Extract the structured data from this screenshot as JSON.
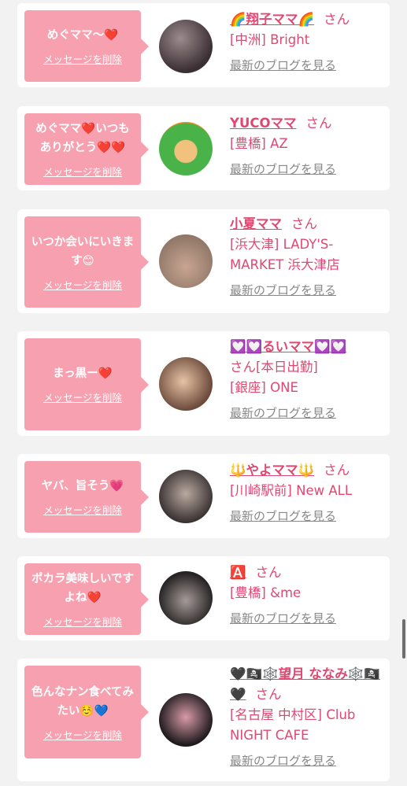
{
  "delete_label": "メッセージを削除",
  "blog_label": "最新のブログを見る",
  "san_label": "さん",
  "cards": [
    {
      "message": "めぐママ〜❤️",
      "name": "🌈翔子ママ🌈",
      "san": "さん",
      "shop": "[中洲] Bright"
    },
    {
      "message": "めぐママ❤️いつもありがとう❤️❤️",
      "name": "YUCOママ",
      "san": "さん",
      "shop": "[豊橋] AZ"
    },
    {
      "message": "いつか会いにいきます😊",
      "name": "小夏ママ",
      "san": "さん",
      "shop": "[浜大津] LADY'S-MARKET 浜大津店"
    },
    {
      "message": "まっ黒ー❤️",
      "name": "💟💟るいママ💟💟",
      "san": "さん[本日出勤]",
      "shop": "[銀座] ONE"
    },
    {
      "message": "ヤバ、旨そう💗",
      "name": "🔱やよママ🔱",
      "san": "さん",
      "shop": "[川崎駅前] New ALL"
    },
    {
      "message": "ポカラ美味しいですよね❤️",
      "name": "🅰️",
      "san": "さん",
      "shop": "[豊橋] &me"
    },
    {
      "message": "色んなナン食べてみたい☺️💙",
      "name": "🖤🏴‍☠️🕸️望月 ななみ🕸️🏴‍☠️🖤",
      "san": "さん",
      "shop": "[名古屋 中村区] Club NIGHT CAFE"
    }
  ]
}
